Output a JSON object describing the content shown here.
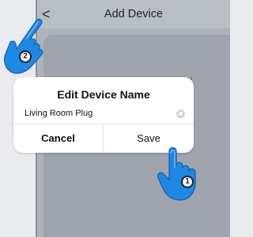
{
  "nav": {
    "back_glyph": "<",
    "title": "Add Device"
  },
  "dialog": {
    "title": "Edit Device Name",
    "input_value": "Living Room Plug",
    "cancel_label": "Cancel",
    "save_label": "Save"
  },
  "peek_text": "y",
  "hints": [
    {
      "step": "1",
      "icon": "tap-hand-icon",
      "target": "save-button"
    },
    {
      "step": "2",
      "icon": "tap-hand-icon",
      "target": "back-button"
    }
  ],
  "colors": {
    "hand": "#1e88e5",
    "hand_light": "#2f98ff",
    "backdrop": "#aeb3bb"
  }
}
